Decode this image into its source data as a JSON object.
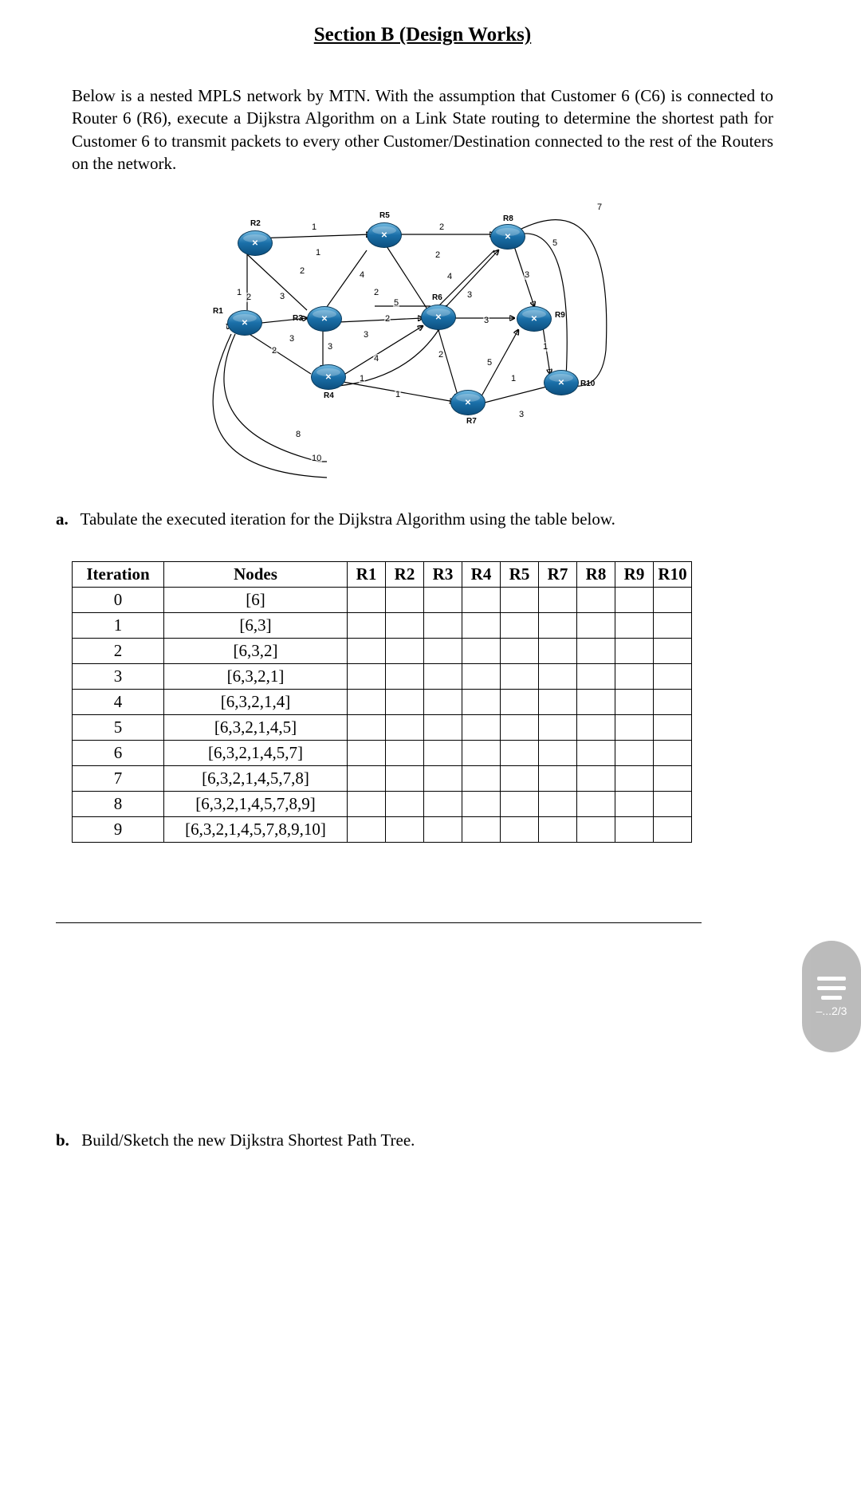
{
  "header": {
    "section_title": "Section B (Design Works)"
  },
  "intro": "Below is a nested MPLS network by MTN. With the assumption that Customer 6 (C6) is connected to Router 6 (R6), execute a Dijkstra Algorithm on a Link State routing to determine the shortest path for Customer 6 to transmit packets to every other Customer/Destination connected to the rest of the Routers on the network.",
  "diagram": {
    "routers": [
      "R1",
      "R2",
      "R3",
      "R4",
      "R5",
      "R6",
      "R7",
      "R8",
      "R9",
      "R10"
    ],
    "edge_weights": [
      "1",
      "1",
      "2",
      "2",
      "2",
      "3",
      "1",
      "2",
      "4",
      "3",
      "5",
      "2",
      "4",
      "2",
      "3",
      "3",
      "3",
      "2",
      "5",
      "3",
      "1",
      "1",
      "2",
      "1",
      "3",
      "7",
      "5",
      "8",
      "10",
      "4",
      "3"
    ]
  },
  "question_a": {
    "marker": "a.",
    "text": "Tabulate the executed iteration for the Dijkstra Algorithm using the table below."
  },
  "table": {
    "headers": {
      "iteration": "Iteration",
      "nodes": "Nodes",
      "r1": "R1",
      "r2": "R2",
      "r3": "R3",
      "r4": "R4",
      "r5": "R5",
      "r7": "R7",
      "r8": "R8",
      "r9": "R9",
      "r10": "R10"
    },
    "rows": [
      {
        "iter": "0",
        "nodes": "[6]"
      },
      {
        "iter": "1",
        "nodes": "[6,3]"
      },
      {
        "iter": "2",
        "nodes": "[6,3,2]"
      },
      {
        "iter": "3",
        "nodes": "[6,3,2,1]"
      },
      {
        "iter": "4",
        "nodes": "[6,3,2,1,4]"
      },
      {
        "iter": "5",
        "nodes": "[6,3,2,1,4,5]"
      },
      {
        "iter": "6",
        "nodes": "[6,3,2,1,4,5,7]"
      },
      {
        "iter": "7",
        "nodes": "[6,3,2,1,4,5,7,8]"
      },
      {
        "iter": "8",
        "nodes": "[6,3,2,1,4,5,7,8,9]"
      },
      {
        "iter": "9",
        "nodes": "[6,3,2,1,4,5,7,8,9,10]"
      }
    ]
  },
  "pager": {
    "label": "–...2/3"
  },
  "question_b": {
    "marker": "b.",
    "text": "Build/Sketch the new Dijkstra Shortest Path Tree."
  }
}
